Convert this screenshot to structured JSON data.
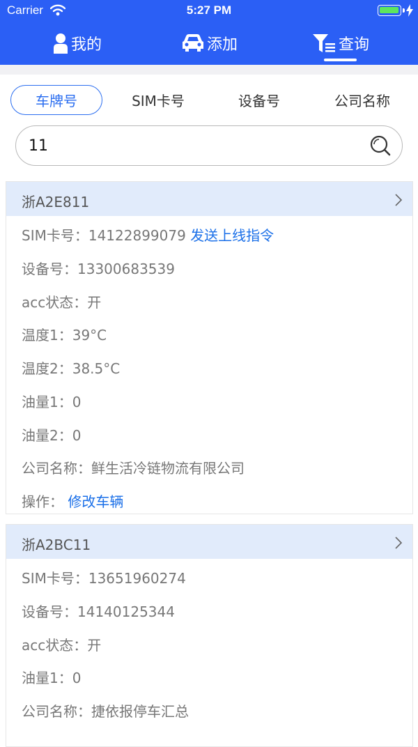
{
  "status": {
    "carrier": "Carrier",
    "time": "5:27 PM"
  },
  "nav": {
    "me": "我的",
    "add": "添加",
    "query": "查询"
  },
  "filters": [
    "车牌号",
    "SIM卡号",
    "设备号",
    "公司名称"
  ],
  "search": {
    "value": "11"
  },
  "vehicles": [
    {
      "plate": "浙A2E811",
      "sim": "SIM卡号：14122899079",
      "sim_action": "发送上线指令",
      "device": "设备号：13300683539",
      "acc": "acc状态：开",
      "temp1": "温度1：39°C",
      "temp2": "温度2：38.5°C",
      "oil1": "油量1：0",
      "oil2": "油量2：0",
      "company": "公司名称：鲜生活冷链物流有限公司",
      "op_label": "操作：",
      "op_action": "修改车辆"
    },
    {
      "plate": "浙A2BC11",
      "sim": "SIM卡号：13651960274",
      "device": "设备号：14140125344",
      "acc": "acc状态：开",
      "oil1": "油量1：0",
      "company": "公司名称：捷依报停车汇总"
    }
  ],
  "colors": {
    "primary": "#2b5ff5",
    "link": "#1a6fe8",
    "card_header": "#e1ebfb"
  }
}
